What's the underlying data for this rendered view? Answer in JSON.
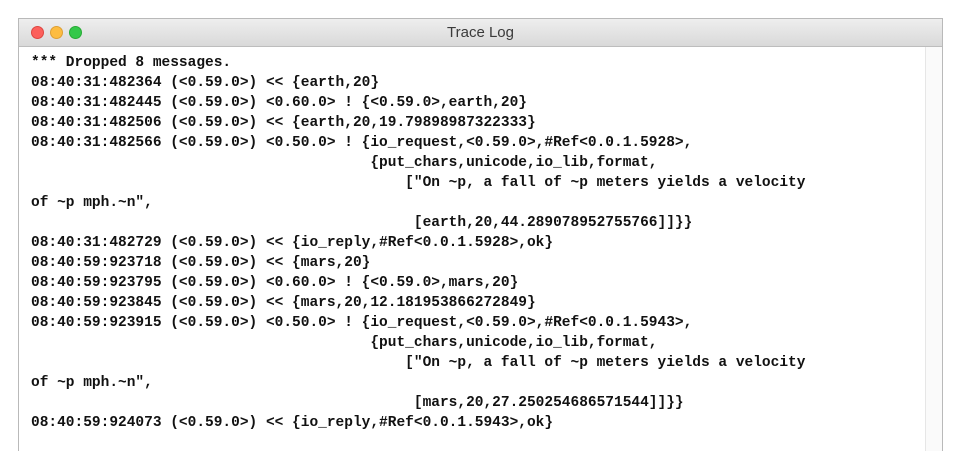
{
  "window": {
    "title": "Trace Log"
  },
  "log": {
    "lines": [
      "*** Dropped 8 messages.",
      "08:40:31:482364 (<0.59.0>) << {earth,20}",
      "08:40:31:482445 (<0.59.0>) <0.60.0> ! {<0.59.0>,earth,20}",
      "08:40:31:482506 (<0.59.0>) << {earth,20,19.79898987322333}",
      "08:40:31:482566 (<0.59.0>) <0.50.0> ! {io_request,<0.59.0>,#Ref<0.0.1.5928>,",
      "                                       {put_chars,unicode,io_lib,format,",
      "                                           [\"On ~p, a fall of ~p meters yields a velocity",
      "of ~p mph.~n\",",
      "                                            [earth,20,44.289078952755766]]}}",
      "08:40:31:482729 (<0.59.0>) << {io_reply,#Ref<0.0.1.5928>,ok}",
      "08:40:59:923718 (<0.59.0>) << {mars,20}",
      "08:40:59:923795 (<0.59.0>) <0.60.0> ! {<0.59.0>,mars,20}",
      "08:40:59:923845 (<0.59.0>) << {mars,20,12.181953866272849}",
      "08:40:59:923915 (<0.59.0>) <0.50.0> ! {io_request,<0.59.0>,#Ref<0.0.1.5943>,",
      "                                       {put_chars,unicode,io_lib,format,",
      "                                           [\"On ~p, a fall of ~p meters yields a velocity",
      "of ~p mph.~n\",",
      "                                            [mars,20,27.250254686571544]]}}",
      "08:40:59:924073 (<0.59.0>) << {io_reply,#Ref<0.0.1.5943>,ok}"
    ]
  }
}
